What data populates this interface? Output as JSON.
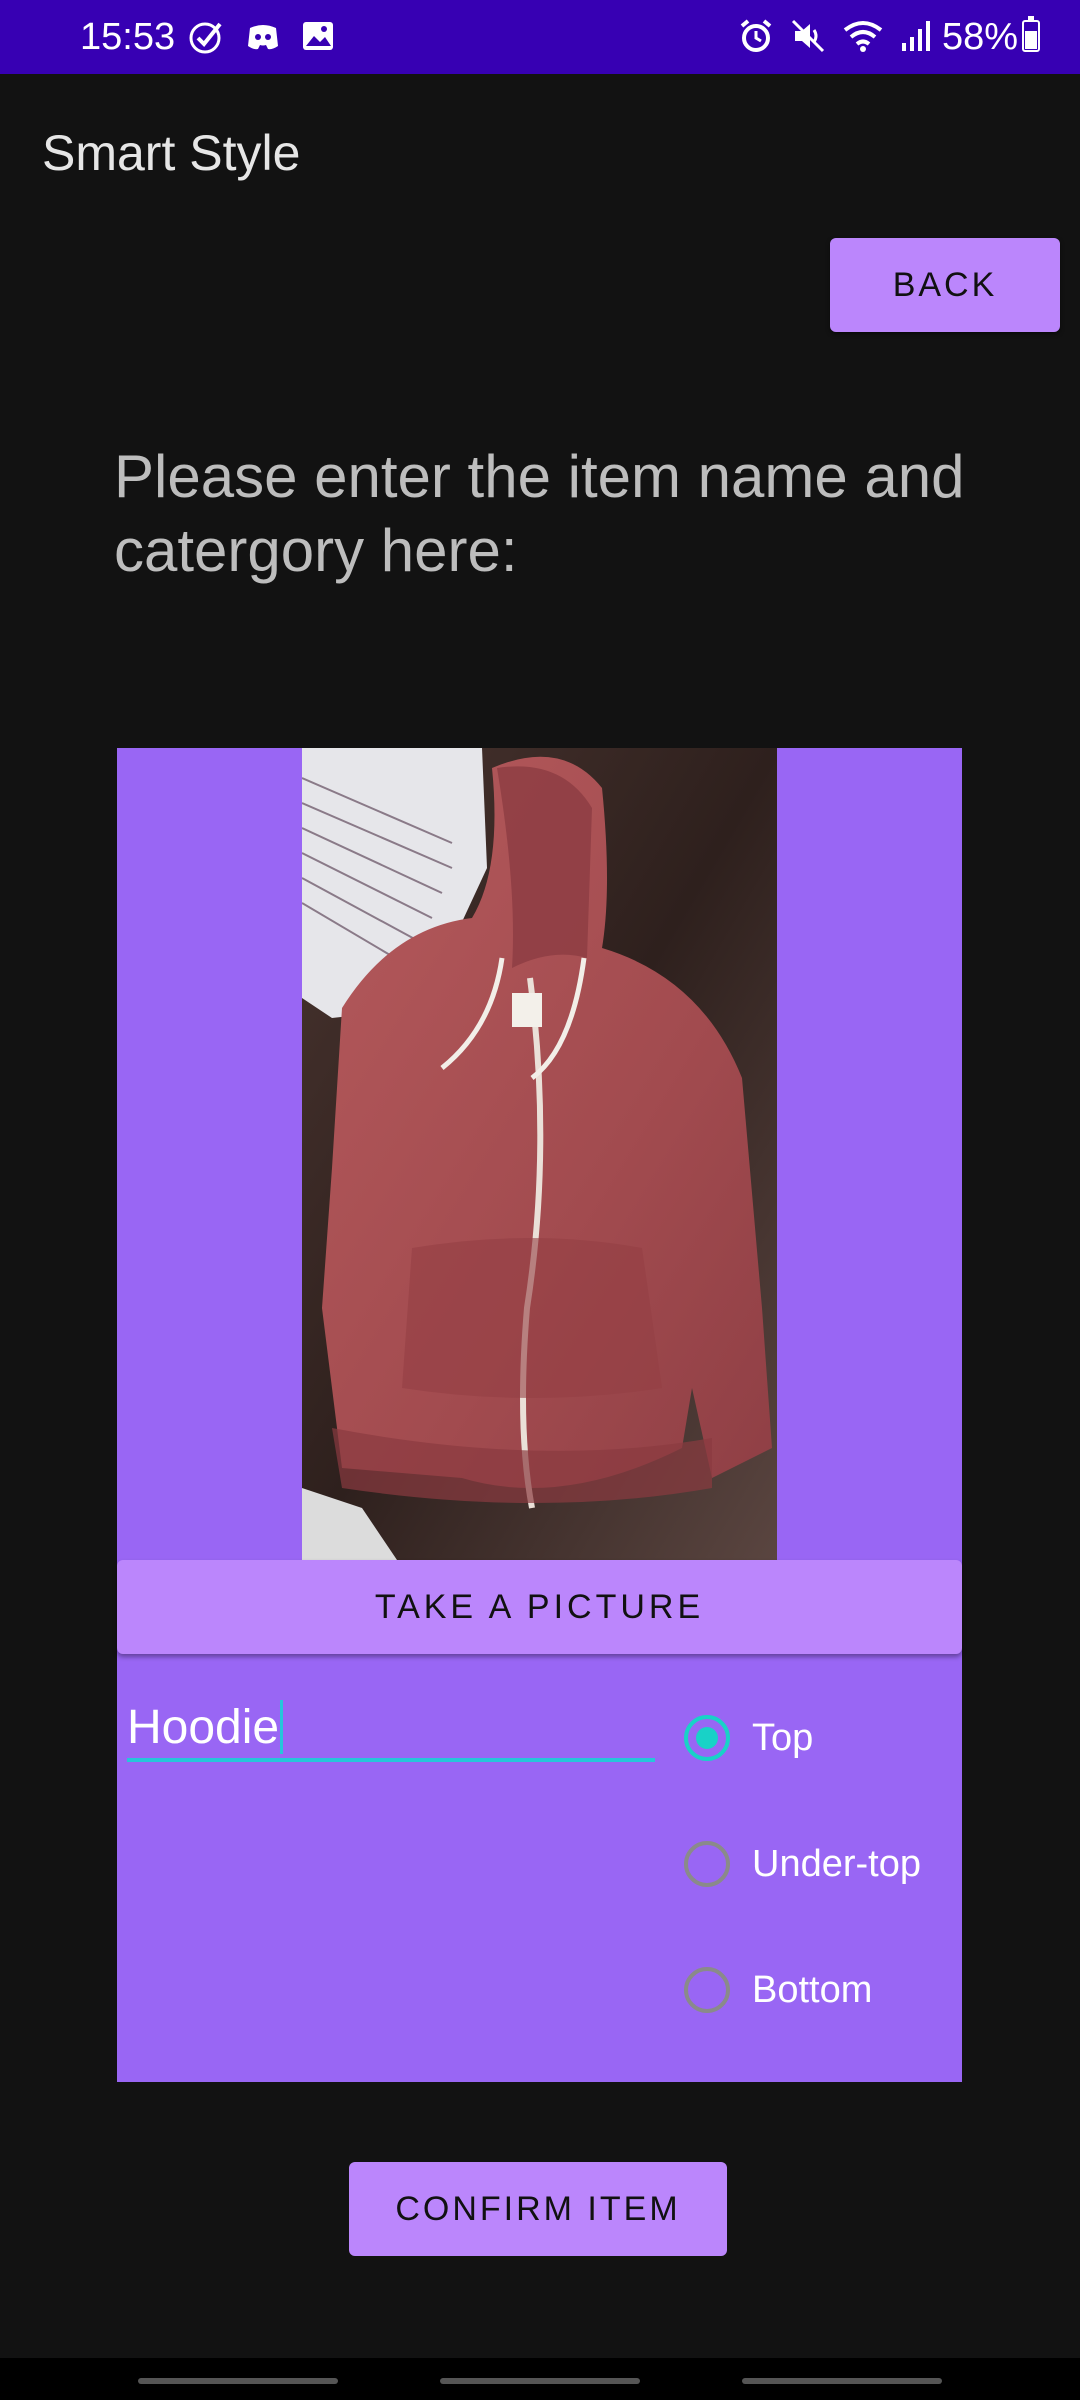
{
  "status_bar": {
    "time": "15:53",
    "battery": "58%",
    "icons_left": [
      "check-circle-icon",
      "discord-icon",
      "image-icon"
    ],
    "icons_right": [
      "alarm-icon",
      "mute-icon",
      "wifi-icon",
      "signal-icon",
      "battery-icon"
    ]
  },
  "app": {
    "title": "Smart Style"
  },
  "header": {
    "back_label": "BACK"
  },
  "main": {
    "instruction": "Please enter the item name and catergory here:",
    "take_picture_label": "TAKE A PICTURE",
    "item_name_value": "Hoodie",
    "category_options": [
      {
        "label": "Top",
        "selected": true
      },
      {
        "label": "Under-top",
        "selected": false
      },
      {
        "label": "Bottom",
        "selected": false
      }
    ],
    "confirm_label": "CONFIRM ITEM"
  },
  "colors": {
    "status_bar": "#3700b3",
    "background": "#121212",
    "button": "#bb86fc",
    "card": "#9966f4",
    "accent": "#18d2c7"
  }
}
